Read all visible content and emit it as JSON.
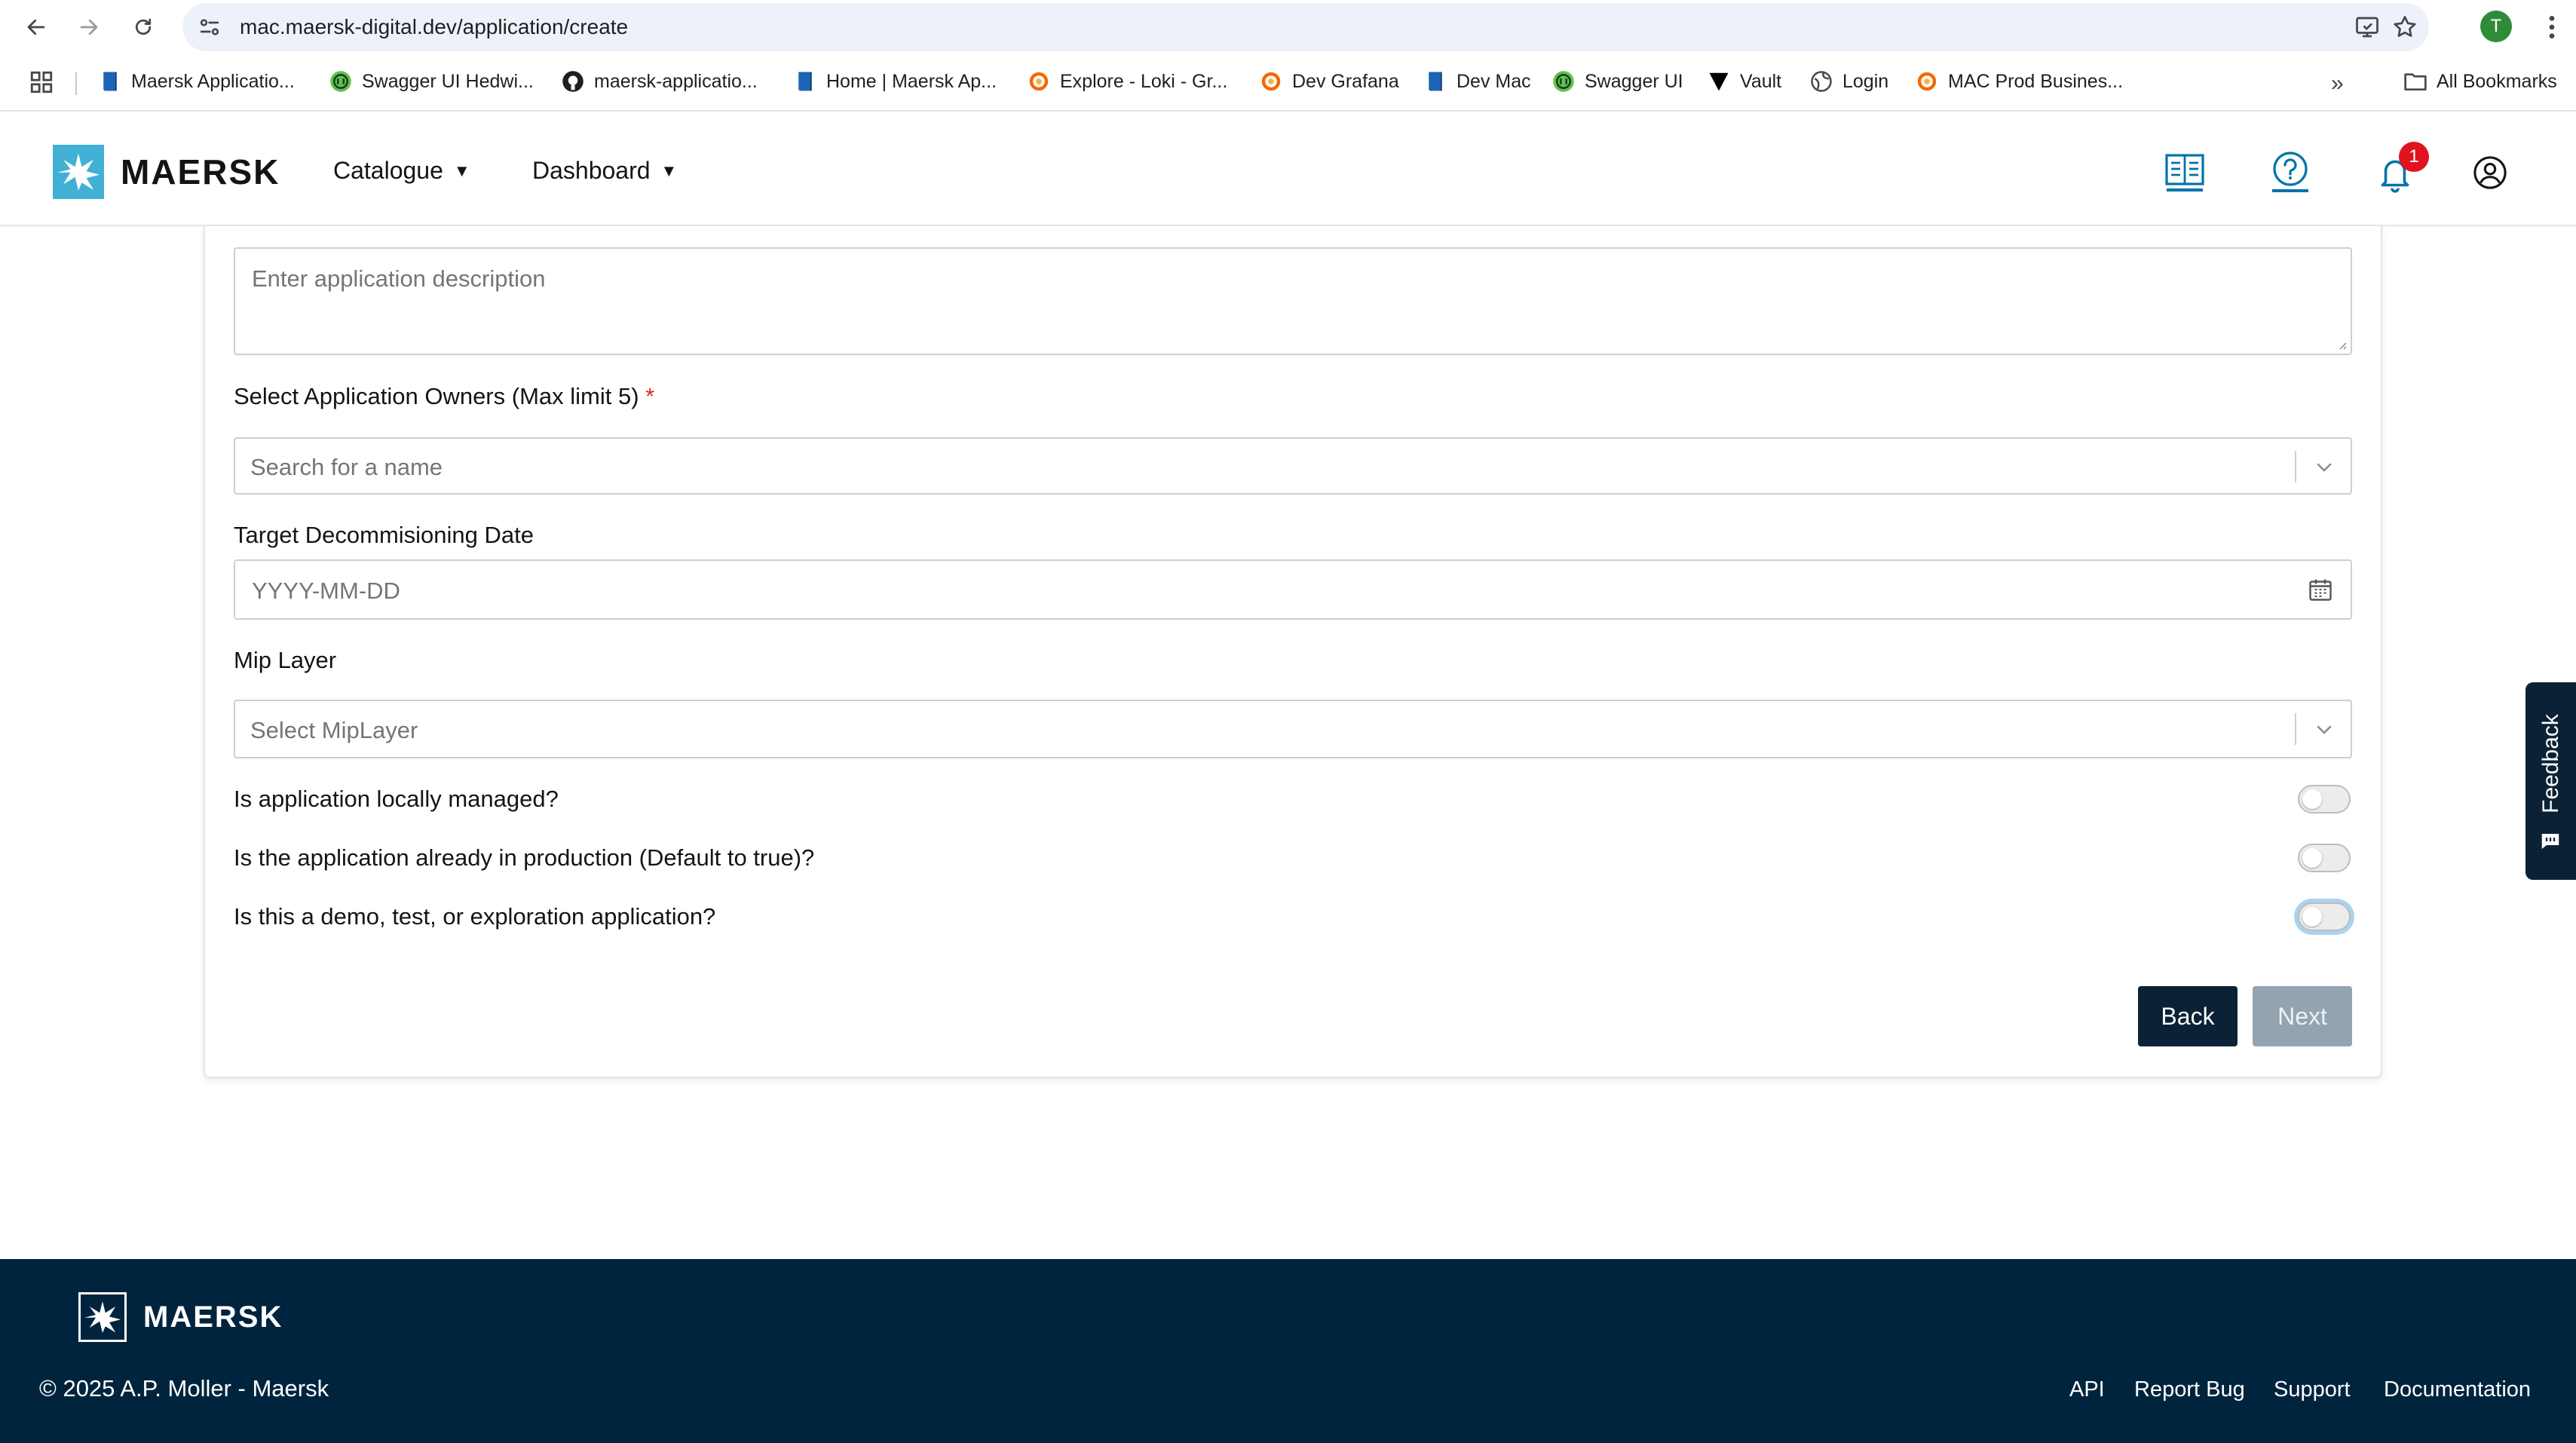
{
  "browser": {
    "url": "mac.maersk-digital.dev/application/create",
    "profile_initial": "T",
    "bookmarks": [
      {
        "label": "Maersk Applicatio..."
      },
      {
        "label": "Swagger UI Hedwi..."
      },
      {
        "label": "maersk-applicatio..."
      },
      {
        "label": "Home | Maersk Ap..."
      },
      {
        "label": "Explore - Loki - Gr..."
      },
      {
        "label": "Dev Grafana"
      },
      {
        "label": "Dev Mac"
      },
      {
        "label": "Swagger UI"
      },
      {
        "label": "Vault"
      },
      {
        "label": "Login"
      },
      {
        "label": "MAC Prod Busines..."
      }
    ],
    "all_bookmarks_label": "All Bookmarks"
  },
  "header": {
    "brand": "MAERSK",
    "menu": [
      {
        "label": "Catalogue"
      },
      {
        "label": "Dashboard"
      }
    ],
    "notification_count": "1"
  },
  "form": {
    "description_placeholder": "Enter application description",
    "owners_label": "Select Application Owners (Max limit 5)",
    "required_mark": "*",
    "owners_placeholder": "Search for a name",
    "decommission_label": "Target Decommisioning Date",
    "decommission_placeholder": "YYYY-MM-DD",
    "mip_label": "Mip Layer",
    "mip_placeholder": "Select MipLayer",
    "toggles": [
      {
        "label": "Is application locally managed?",
        "on": false
      },
      {
        "label": "Is the application already in production (Default to true)?",
        "on": false
      },
      {
        "label": "Is this a demo, test, or exploration application?",
        "on": false
      }
    ],
    "back_label": "Back",
    "next_label": "Next"
  },
  "feedback_label": "Feedback",
  "footer": {
    "brand": "MAERSK",
    "copyright": "© 2025 A.P. Moller - Maersk",
    "links": [
      {
        "label": "API"
      },
      {
        "label": "Report Bug"
      },
      {
        "label": "Support"
      },
      {
        "label": "Documentation"
      }
    ]
  },
  "colors": {
    "brand_blue": "#42b0d5",
    "dark_navy": "#00243d",
    "button_primary": "#0b2236",
    "button_disabled": "#94a3b0",
    "required": "#d62d23",
    "notification_badge": "#e0141e",
    "header_icon": "#0073ab"
  }
}
